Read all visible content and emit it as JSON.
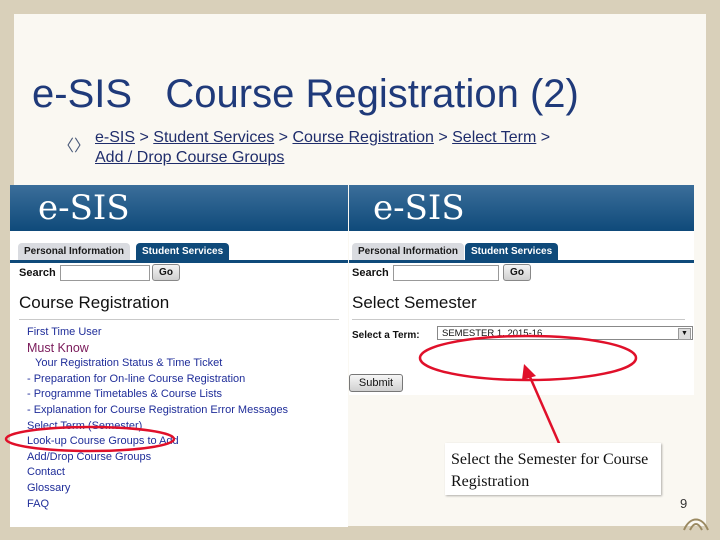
{
  "slide": {
    "title": "e-SIS   Course Registration (2)",
    "page_number": "9"
  },
  "breadcrumb": {
    "items": [
      "e-SIS",
      "Student Services",
      "Course Registration",
      "Select Term",
      "Add / Drop Course Groups"
    ],
    "separator": ">"
  },
  "left_screen": {
    "logo": "e-SIS",
    "tabs": [
      "Personal Information",
      "Student Services"
    ],
    "search_label": "Search",
    "search_value": "",
    "go_label": "Go",
    "heading": "Course Registration",
    "menu": [
      "First Time User",
      "Must Know",
      "Your Registration Status & Time Ticket",
      "- Preparation for On-line Course Registration",
      "- Programme Timetables & Course Lists",
      "- Explanation for Course Registration Error Messages",
      "Select Term (Semester)",
      "Look-up Course Groups to Add",
      "Add/Drop Course Groups",
      "Contact",
      "Glossary",
      "FAQ"
    ]
  },
  "right_screen": {
    "logo": "e-SIS",
    "tabs": [
      "Personal Information",
      "Student Services"
    ],
    "search_label": "Search",
    "search_value": "",
    "go_label": "Go",
    "heading": "Select Semester",
    "select_label": "Select a Term:",
    "select_value": "SEMESTER 1, 2015-16",
    "submit_label": "Submit"
  },
  "callout": {
    "text": "Select the Semester for Course Registration"
  },
  "colors": {
    "title": "#1f3a7a",
    "banner": "#0f4a7a",
    "highlight": "#e0102a",
    "menu_link": "#1f2d99"
  }
}
